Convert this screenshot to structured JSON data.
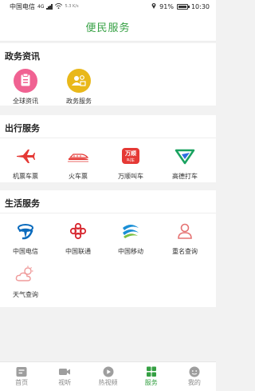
{
  "status_bar": {
    "carrier": "中国电信",
    "network": "4G",
    "speed": "5.3 K/s",
    "battery": "91%",
    "time": "10:30"
  },
  "header": {
    "title": "便民服务"
  },
  "sections": [
    {
      "title": "政务资讯",
      "items": [
        {
          "label": "全球资讯",
          "icon": "news-clipboard-icon"
        },
        {
          "label": "政务服务",
          "icon": "government-service-icon"
        }
      ]
    },
    {
      "title": "出行服务",
      "items": [
        {
          "label": "机票车票",
          "icon": "airplane-icon"
        },
        {
          "label": "火车票",
          "icon": "train-icon"
        },
        {
          "label": "万顺叫车",
          "icon": "wanshun-logo-icon",
          "logo_text": "万顺 叫车"
        },
        {
          "label": "高德打车",
          "icon": "amap-taxi-icon"
        }
      ]
    },
    {
      "title": "生活服务",
      "items": [
        {
          "label": "中国电信",
          "icon": "china-telecom-logo-icon"
        },
        {
          "label": "中国联通",
          "icon": "china-unicom-logo-icon"
        },
        {
          "label": "中国移动",
          "icon": "china-mobile-logo-icon"
        },
        {
          "label": "重名查询",
          "icon": "person-search-icon"
        },
        {
          "label": "天气查询",
          "icon": "weather-cloud-icon"
        }
      ]
    }
  ],
  "tab_bar": {
    "active": "服务",
    "tabs": [
      {
        "label": "首页",
        "icon": "home-icon"
      },
      {
        "label": "视听",
        "icon": "video-camera-icon"
      },
      {
        "label": "热视频",
        "icon": "play-icon"
      },
      {
        "label": "服务",
        "icon": "grid-icon"
      },
      {
        "label": "我的",
        "icon": "profile-icon"
      }
    ]
  },
  "colors": {
    "accent": "#35a043",
    "page_bg": "#f2f2f2",
    "news_icon": "#f06292",
    "gov_icon": "#e9b81a",
    "travel_red": "#e53935",
    "amap_green": "#1aa260",
    "amap_blue": "#2f6fe0",
    "telecom_blue": "#0b6bbd",
    "unicom_red": "#d7262e",
    "mobile_blue": "#1a8fd6",
    "mobile_green": "#7bc043",
    "person_red": "#e57373",
    "weather_pink": "#ef9a9a"
  }
}
